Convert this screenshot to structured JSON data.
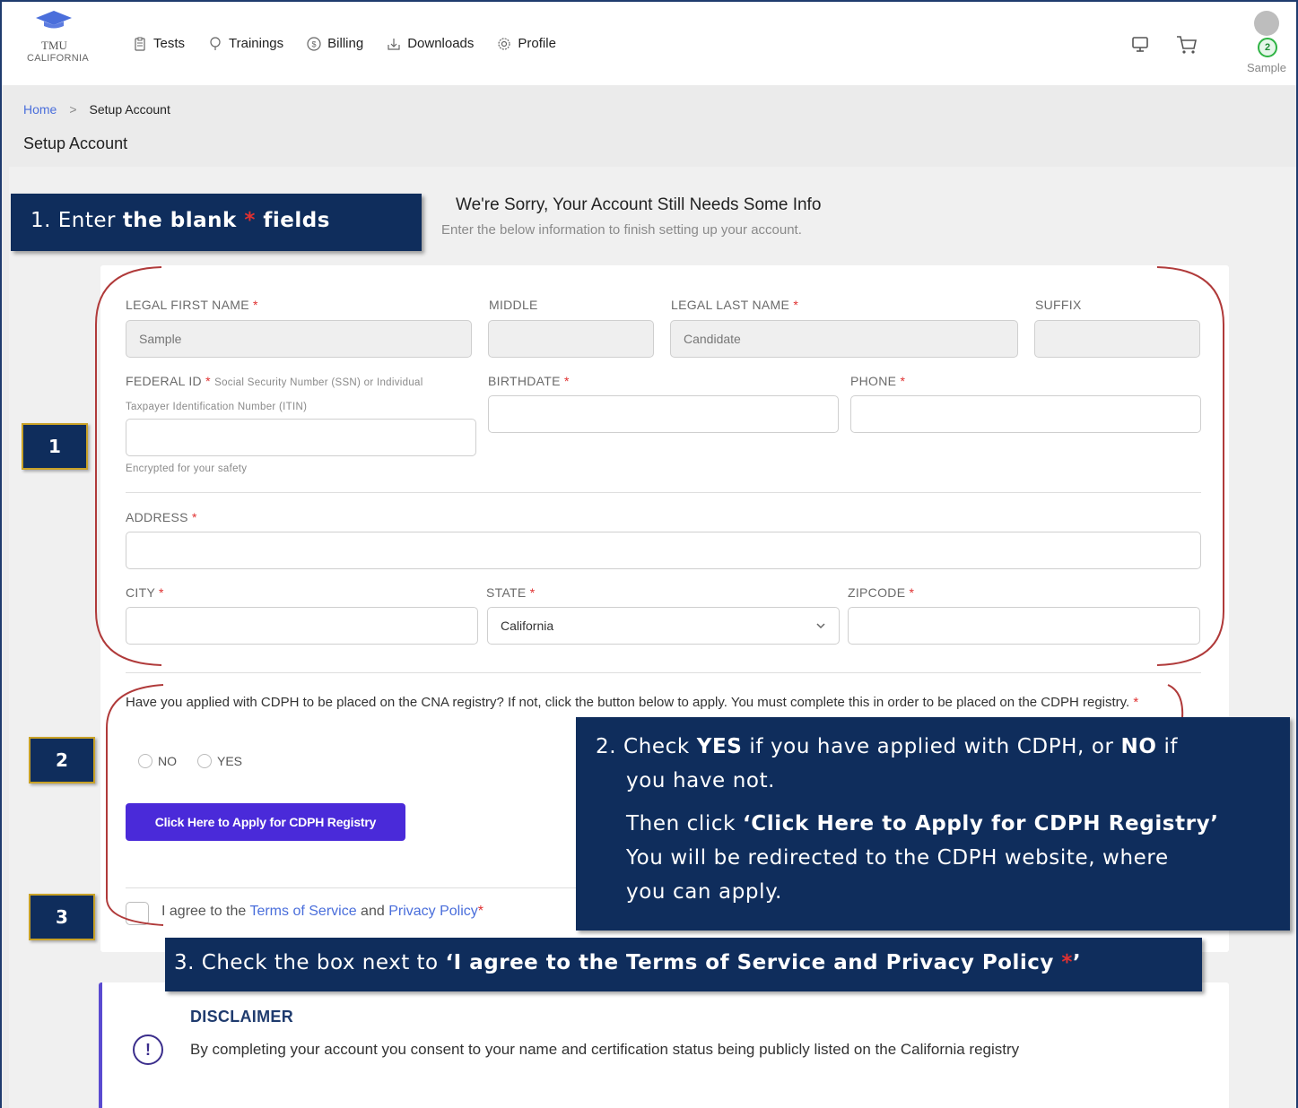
{
  "logo": {
    "line1": "TMU",
    "line2": "CALIFORNIA"
  },
  "nav": {
    "items": [
      {
        "label": "Tests",
        "icon": "clipboard-icon"
      },
      {
        "label": "Trainings",
        "icon": "bulb-icon"
      },
      {
        "label": "Billing",
        "icon": "dollar-icon"
      },
      {
        "label": "Downloads",
        "icon": "download-icon"
      },
      {
        "label": "Profile",
        "icon": "gear-icon"
      }
    ],
    "cart_count": "2",
    "user_name": "Sample"
  },
  "breadcrumb": {
    "home": "Home",
    "separator": ">",
    "current": "Setup Account"
  },
  "page_title": "Setup Account",
  "heading": {
    "title": "We're Sorry, Your Account Still Needs Some Info",
    "subtitle": "Enter the below information to finish setting up your account."
  },
  "form": {
    "first_name": {
      "label": "LEGAL FIRST NAME",
      "value": "Sample"
    },
    "middle": {
      "label": "MIDDLE",
      "value": ""
    },
    "last_name": {
      "label": "LEGAL LAST NAME",
      "value": "Candidate"
    },
    "suffix": {
      "label": "SUFFIX",
      "value": ""
    },
    "federal_id": {
      "label": "FEDERAL ID",
      "help_line1": "Social Security Number (SSN) or Individual",
      "help_line2": "Taxpayer Identification Number (ITIN)",
      "note": "Encrypted for your safety"
    },
    "birthdate": {
      "label": "BIRTHDATE"
    },
    "phone": {
      "label": "PHONE"
    },
    "address": {
      "label": "ADDRESS"
    },
    "city": {
      "label": "CITY"
    },
    "state": {
      "label": "STATE",
      "value": "California"
    },
    "zipcode": {
      "label": "ZIPCODE"
    },
    "required_mark": "*"
  },
  "cdph": {
    "question": "Have you applied with CDPH to be placed on the CNA registry?  If not, click the button below to apply. You must complete this in order to be placed on the CDPH registry.",
    "no_label": "NO",
    "yes_label": "YES",
    "button": "Click Here to Apply for CDPH Registry"
  },
  "terms": {
    "prefix": "I agree to the",
    "tos": "Terms of Service",
    "and": "and",
    "privacy": "Privacy Policy"
  },
  "disclaimer": {
    "title": "DISCLAIMER",
    "icon": "!",
    "text": "By completing your account you consent to your name and certification status being publicly listed on the California registry"
  },
  "annotations": {
    "step1": {
      "prefix": "1. Enter ",
      "bold": "the blank ",
      "star": "*",
      "bold2": " fields"
    },
    "step2_line1_a": "2.  Check ",
    "step2_line1_yes": "YES",
    "step2_line1_b": " if you have applied with CDPH, or ",
    "step2_line1_no": "NO",
    "step2_line1_c": " if",
    "step2_line2": "you have not.",
    "step2_line3_a": "Then click ",
    "step2_line3_b": "‘Click Here to Apply for CDPH Registry’",
    "step2_line4": "You will be redirected to the CDPH website, where",
    "step2_line5": "you can apply.",
    "step3_a": "3.   Check the box next to ",
    "step3_b": "‘I agree to the Terms of Service and Privacy Policy ",
    "step3_star": "*",
    "step3_c": "’",
    "badge1": "1",
    "badge2": "2",
    "badge3": "3"
  },
  "colors": {
    "accent": "#4a2ad9",
    "annotation_bg": "#0f2d5c",
    "bracket": "#b03a3a",
    "required": "#e03131",
    "badge_border": "#c9a227"
  }
}
